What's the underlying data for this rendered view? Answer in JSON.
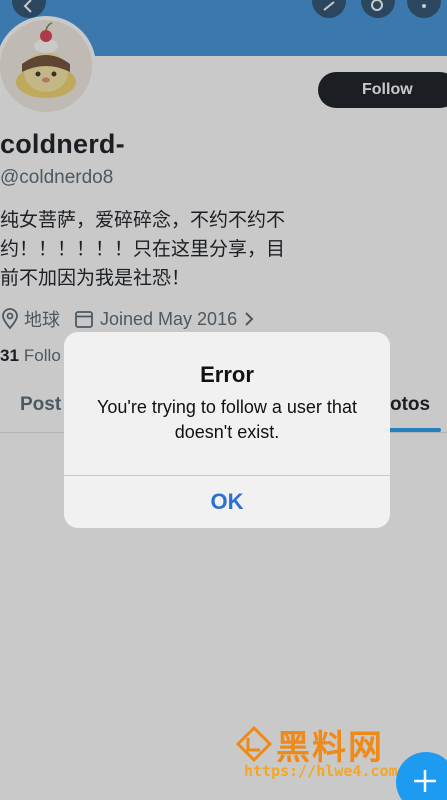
{
  "header": {
    "back_icon": "back-arrow-icon",
    "grok_icon": "grok-icon",
    "search_icon": "search-icon",
    "more_icon": "more-icon",
    "banner_color": "#3b8fd9"
  },
  "profile": {
    "follow_label": "Follow",
    "display_name": "coldnerd-",
    "handle": "@coldnerdo8",
    "bio": "纯女菩萨，爱碎碎念，不约不约不约！！！！！！只在这里分享，目前不加因为我是社恐！",
    "location": "地球",
    "joined": "Joined May 2016",
    "following_count": "31",
    "following_label": "Follo"
  },
  "tabs": {
    "posts": "Post",
    "photos": "otos"
  },
  "alert": {
    "title": "Error",
    "message": "You're trying to follow a user that doesn't exist.",
    "ok_label": "OK"
  },
  "fab": {
    "icon": "plus-icon"
  },
  "watermark": {
    "title": "黑料网",
    "url": "https://hlwe4.com"
  },
  "colors": {
    "accent": "#1d9bf0",
    "follow_button": "#0f1419",
    "alert_button_text": "#2f6fcf"
  }
}
